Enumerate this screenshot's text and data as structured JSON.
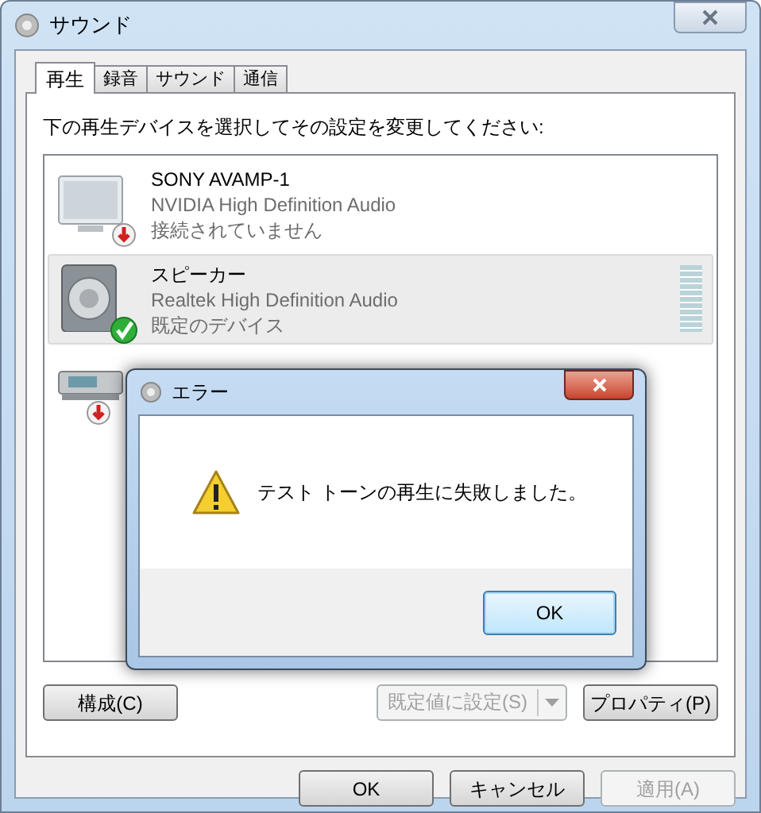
{
  "window": {
    "title": "サウンド"
  },
  "tabs": [
    {
      "label": "再生",
      "selected": true
    },
    {
      "label": "録音",
      "selected": false
    },
    {
      "label": "サウンド",
      "selected": false
    },
    {
      "label": "通信",
      "selected": false
    }
  ],
  "instruction": "下の再生デバイスを選択してその設定を変更してください:",
  "devices": [
    {
      "kind": "monitor",
      "name": "SONY AVAMP-1",
      "driver": "NVIDIA High Definition Audio",
      "status": "接続されていません",
      "connected": false,
      "selected": false
    },
    {
      "kind": "speaker",
      "name": "スピーカー",
      "driver": "Realtek High Definition Audio",
      "status": "既定のデバイス",
      "connected": true,
      "selected": true
    },
    {
      "kind": "receiver",
      "connected": false,
      "selected": false
    }
  ],
  "panel_buttons": [
    {
      "kind": "push",
      "label": "構成(C)",
      "disabled": false
    },
    {
      "kind": "split",
      "label": "既定値に設定(S)",
      "disabled": true
    },
    {
      "kind": "push",
      "label": "プロパティ(P)",
      "disabled": false
    }
  ],
  "footer_buttons": [
    {
      "label": "OK",
      "disabled": false
    },
    {
      "label": "キャンセル",
      "disabled": false
    },
    {
      "label": "適用(A)",
      "disabled": true
    }
  ],
  "dialog": {
    "title": "エラー",
    "message": "テスト トーンの再生に失敗しました。",
    "button": "OK"
  }
}
